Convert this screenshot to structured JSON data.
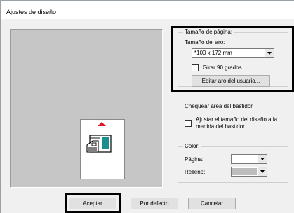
{
  "window": {
    "title": "Ajustes de diseño"
  },
  "page_size": {
    "group_label": "Tamaño de página:",
    "hoop_label": "Tamaño del aro:",
    "hoop_value": "*100 x 172 mm",
    "rotate_label": "Girar 90 grados",
    "rotate_checked": false,
    "edit_button": "Editar aro del usuario..."
  },
  "check_area": {
    "group_label": "Chequear área del bastidor",
    "adjust_line1": "Ajustar el tamaño del diseño a la",
    "adjust_line2": "medida del bastidor.",
    "adjust_checked": false
  },
  "color": {
    "group_label": "Color:",
    "page_label": "Página:",
    "page_color": "#ffffff",
    "fill_label": "Relleno:",
    "fill_color": "#bdbdbd"
  },
  "buttons": {
    "accept": "Aceptar",
    "default": "Por defecto",
    "cancel": "Cancelar"
  },
  "colors": {
    "hoop_arrow": "#e0142c",
    "machine_accent": "#1a8f8f",
    "highlight": "#000000"
  }
}
